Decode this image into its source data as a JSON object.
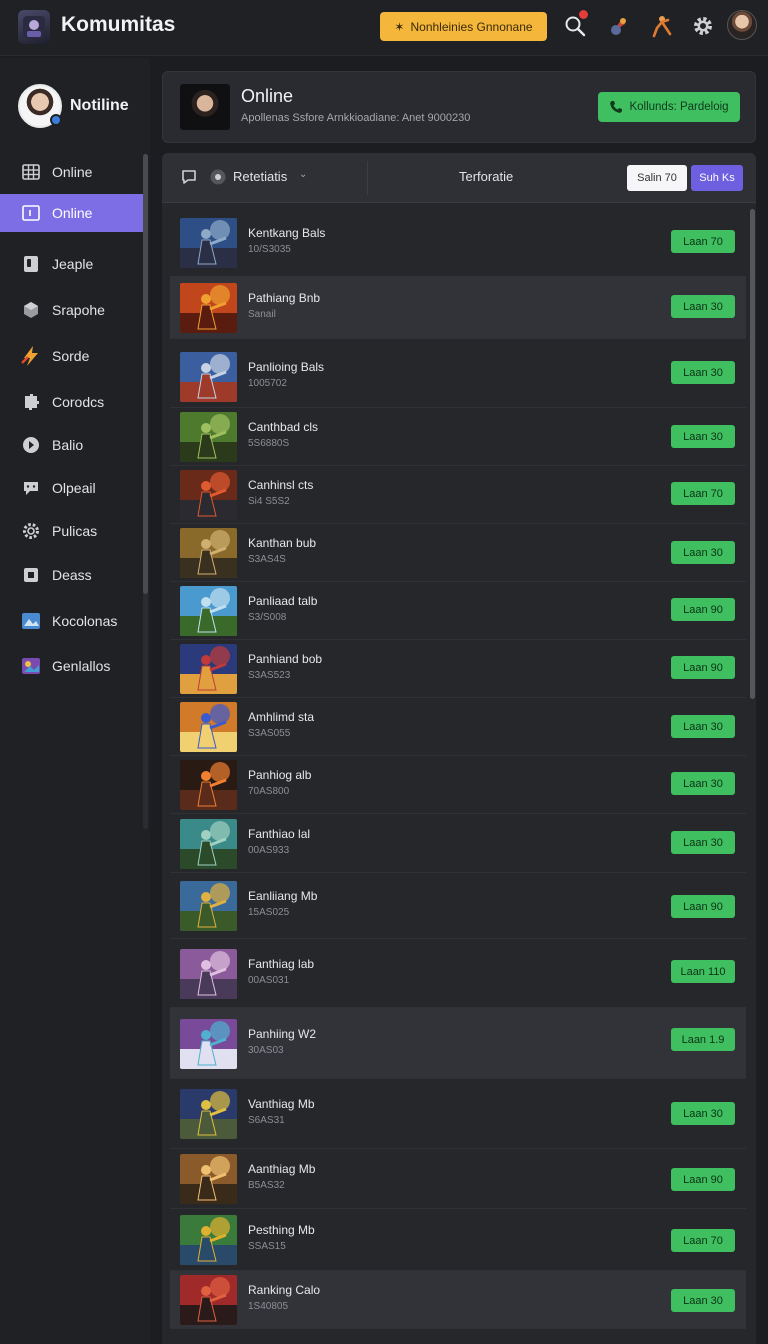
{
  "app": {
    "title": "Komumitas"
  },
  "topbar": {
    "notif_button": "Nonhleinies Gnnonane",
    "icons": [
      "search-icon",
      "rocket-icon",
      "fighter-icon",
      "gear-icon",
      "user-avatar"
    ]
  },
  "sidebar": {
    "profile_name": "Notiline",
    "items": [
      {
        "label": "Online",
        "icon": "grid-icon",
        "active": false
      },
      {
        "label": "Online",
        "icon": "window-icon",
        "active": true
      },
      {
        "label": "Jeaple",
        "icon": "device-icon",
        "active": false
      },
      {
        "label": "Srapohe",
        "icon": "cube-icon",
        "active": false
      },
      {
        "label": "Sorde",
        "icon": "lightning-icon",
        "active": false
      },
      {
        "label": "Corodcs",
        "icon": "puzzle-icon",
        "active": false
      },
      {
        "label": "Balio",
        "icon": "play-icon",
        "active": false
      },
      {
        "label": "Olpeail",
        "icon": "chat-icon",
        "active": false
      },
      {
        "label": "Pulicas",
        "icon": "cog-icon",
        "active": false
      },
      {
        "label": "Deass",
        "icon": "square-icon",
        "active": false
      },
      {
        "label": "Kocolonas",
        "icon": "picture-icon",
        "active": false
      },
      {
        "label": "Genlallos",
        "icon": "gallery-icon",
        "active": false
      }
    ]
  },
  "header": {
    "title": "Online",
    "subtitle": "Apollenas Ssfore Arnkkioadiane: Anet 9000230",
    "call_button": "Kollunds: Pardeloig"
  },
  "toolbar": {
    "filter_label": "Retetiatis",
    "column_label": "Terforatie",
    "white_button": "Salin 70",
    "purple_button": "Suh Ks"
  },
  "rows": [
    {
      "title": "Kentkang Bals",
      "sub": "10/S3035",
      "button": "Laan 70",
      "highlight": false,
      "colors": [
        "#2e4f86",
        "#8fa9c8",
        "#2a2f45"
      ]
    },
    {
      "title": "Pathiang Bnb",
      "sub": "Sanail",
      "button": "Laan 30",
      "highlight": true,
      "colors": [
        "#c2461c",
        "#f0a030",
        "#5a1c0e"
      ]
    },
    {
      "title": "Panlioing Bals",
      "sub": "1005702",
      "button": "Laan 30",
      "highlight": false,
      "colors": [
        "#3a5e9e",
        "#c7d3e4",
        "#9e3a2a"
      ]
    },
    {
      "title": "Canthbad cls",
      "sub": "5S6880S",
      "button": "Laan 30",
      "highlight": false,
      "colors": [
        "#4e7a2e",
        "#a0c060",
        "#2a3a1a"
      ]
    },
    {
      "title": "Canhinsl cts",
      "sub": "Si4 S5S2",
      "button": "Laan 70",
      "highlight": false,
      "colors": [
        "#6a2a1a",
        "#e05a30",
        "#2a2a30"
      ]
    },
    {
      "title": "Kanthan bub",
      "sub": "S3AS4S",
      "button": "Laan 30",
      "highlight": false,
      "colors": [
        "#8a6a2a",
        "#d0b070",
        "#3a3020"
      ]
    },
    {
      "title": "Panliaad talb",
      "sub": "S3/S008",
      "button": "Laan 90",
      "highlight": false,
      "colors": [
        "#4a9ad0",
        "#c0e0f0",
        "#3a6a2a"
      ]
    },
    {
      "title": "Panhiand bob",
      "sub": "S3AS523",
      "button": "Laan 90",
      "highlight": false,
      "colors": [
        "#2a3a7a",
        "#c03a3a",
        "#e0a040"
      ]
    },
    {
      "title": "Amhlimd sta",
      "sub": "S3AS055",
      "button": "Laan 30",
      "highlight": false,
      "colors": [
        "#d07a2a",
        "#3a5ad0",
        "#f0d070"
      ]
    },
    {
      "title": "Panhiog alb",
      "sub": "70AS800",
      "button": "Laan 30",
      "highlight": false,
      "colors": [
        "#2a1a14",
        "#f08030",
        "#5a2a1a"
      ]
    },
    {
      "title": "Fanthiao lal",
      "sub": "00AS933",
      "button": "Laan 30",
      "highlight": false,
      "colors": [
        "#3a8a8a",
        "#a0d0c0",
        "#2a4a2a"
      ]
    },
    {
      "title": "Eanliiang Mb",
      "sub": "15AS025",
      "button": "Laan 90",
      "highlight": false,
      "colors": [
        "#3a6a9a",
        "#e0b040",
        "#3a5a2a"
      ]
    },
    {
      "title": "Fanthiag lab",
      "sub": "00AS031",
      "button": "Laan 110",
      "highlight": false,
      "colors": [
        "#8a5a9a",
        "#e0c0e0",
        "#4a3a5a"
      ]
    },
    {
      "title": "Panhiing W2",
      "sub": "30AS03",
      "button": "Laan 1.9",
      "highlight": true,
      "colors": [
        "#7a4a9a",
        "#50b0d0",
        "#e0e0f0"
      ]
    },
    {
      "title": "Vanthiag Mb",
      "sub": "S6AS31",
      "button": "Laan 30",
      "highlight": false,
      "colors": [
        "#2a3a6a",
        "#e0c040",
        "#4a5a3a"
      ]
    },
    {
      "title": "Aanthiag Mb",
      "sub": "B5AS32",
      "button": "Laan 90",
      "highlight": false,
      "colors": [
        "#8a5a2a",
        "#f0c070",
        "#3a2a1a"
      ]
    },
    {
      "title": "Pesthing Mb",
      "sub": "SSAS15",
      "button": "Laan 70",
      "highlight": false,
      "colors": [
        "#3a7a3a",
        "#e0b030",
        "#2a4a6a"
      ]
    },
    {
      "title": "Ranking Calo",
      "sub": "1S40805",
      "button": "Laan 30",
      "highlight": true,
      "colors": [
        "#a02a2a",
        "#e06040",
        "#2a1a1a"
      ]
    }
  ]
}
